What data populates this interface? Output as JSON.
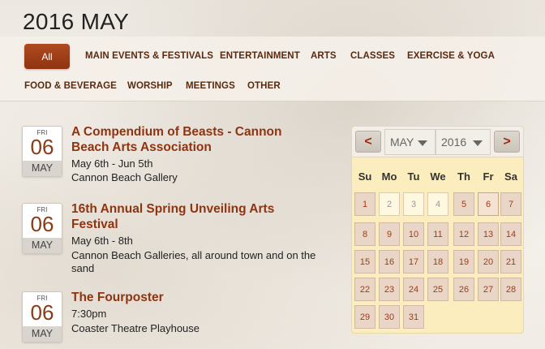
{
  "header": {
    "title": "2016 MAY"
  },
  "filters": {
    "all": "All",
    "items": [
      "MAIN EVENTS & FESTIVALS",
      "ENTERTAINMENT",
      "ARTS",
      "CLASSES",
      "EXERCISE & YOGA",
      "FOOD & BEVERAGE",
      "WORSHIP",
      "MEETINGS",
      "OTHER"
    ]
  },
  "events": [
    {
      "dow": "FRI",
      "day": "06",
      "month": "MAY",
      "title": "A Compendium of Beasts - Cannon Beach Arts Association",
      "dates": "May 6th - Jun 5th",
      "location": "Cannon Beach Gallery"
    },
    {
      "dow": "FRI",
      "day": "06",
      "month": "MAY",
      "title": "16th Annual Spring Unveiling Arts Festival",
      "dates": "May 6th - 8th",
      "location": "Cannon Beach Galleries, all around town and on the sand"
    },
    {
      "dow": "FRI",
      "day": "06",
      "month": "MAY",
      "title": "The Fourposter",
      "dates": "7:30pm",
      "location": "Coaster Theatre Playhouse"
    }
  ],
  "calendar": {
    "prev": "<",
    "next": ">",
    "month": "MAY",
    "year": "2016",
    "weekdays": [
      "Su",
      "Mo",
      "Tu",
      "We",
      "Th",
      "Fr",
      "Sa"
    ],
    "days": [
      "1",
      "2",
      "3",
      "4",
      "5",
      "6",
      "7",
      "8",
      "9",
      "10",
      "11",
      "12",
      "13",
      "14",
      "15",
      "16",
      "17",
      "18",
      "19",
      "20",
      "21",
      "22",
      "23",
      "24",
      "25",
      "26",
      "27",
      "28",
      "29",
      "30",
      "31"
    ],
    "past_days": [
      "2",
      "3",
      "4"
    ],
    "selected_day": "6"
  }
}
